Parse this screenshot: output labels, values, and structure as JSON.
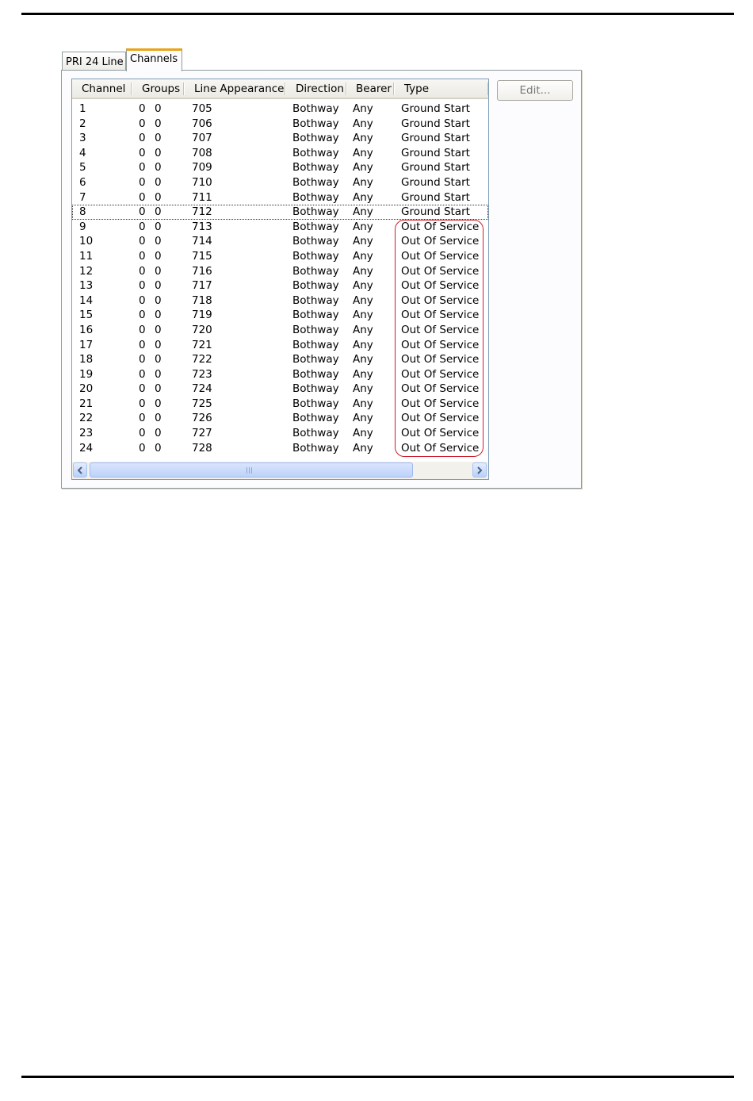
{
  "tabs": [
    {
      "label": "PRI 24 Line"
    },
    {
      "label": "Channels"
    }
  ],
  "columns": [
    "Channel",
    "Groups",
    "Line Appearance",
    "Direction",
    "Bearer",
    "Type"
  ],
  "edit_button": "Edit...",
  "rows": [
    {
      "channel": "1",
      "group_in": "0",
      "group_out": "0",
      "line_appearance": "705",
      "direction": "Bothway",
      "bearer": "Any",
      "type": "Ground Start"
    },
    {
      "channel": "2",
      "group_in": "0",
      "group_out": "0",
      "line_appearance": "706",
      "direction": "Bothway",
      "bearer": "Any",
      "type": "Ground Start"
    },
    {
      "channel": "3",
      "group_in": "0",
      "group_out": "0",
      "line_appearance": "707",
      "direction": "Bothway",
      "bearer": "Any",
      "type": "Ground Start"
    },
    {
      "channel": "4",
      "group_in": "0",
      "group_out": "0",
      "line_appearance": "708",
      "direction": "Bothway",
      "bearer": "Any",
      "type": "Ground Start"
    },
    {
      "channel": "5",
      "group_in": "0",
      "group_out": "0",
      "line_appearance": "709",
      "direction": "Bothway",
      "bearer": "Any",
      "type": "Ground Start"
    },
    {
      "channel": "6",
      "group_in": "0",
      "group_out": "0",
      "line_appearance": "710",
      "direction": "Bothway",
      "bearer": "Any",
      "type": "Ground Start"
    },
    {
      "channel": "7",
      "group_in": "0",
      "group_out": "0",
      "line_appearance": "711",
      "direction": "Bothway",
      "bearer": "Any",
      "type": "Ground Start"
    },
    {
      "channel": "8",
      "group_in": "0",
      "group_out": "0",
      "line_appearance": "712",
      "direction": "Bothway",
      "bearer": "Any",
      "type": "Ground Start",
      "focused": true
    },
    {
      "channel": "9",
      "group_in": "0",
      "group_out": "0",
      "line_appearance": "713",
      "direction": "Bothway",
      "bearer": "Any",
      "type": "Out Of Service"
    },
    {
      "channel": "10",
      "group_in": "0",
      "group_out": "0",
      "line_appearance": "714",
      "direction": "Bothway",
      "bearer": "Any",
      "type": "Out Of Service"
    },
    {
      "channel": "11",
      "group_in": "0",
      "group_out": "0",
      "line_appearance": "715",
      "direction": "Bothway",
      "bearer": "Any",
      "type": "Out Of Service"
    },
    {
      "channel": "12",
      "group_in": "0",
      "group_out": "0",
      "line_appearance": "716",
      "direction": "Bothway",
      "bearer": "Any",
      "type": "Out Of Service"
    },
    {
      "channel": "13",
      "group_in": "0",
      "group_out": "0",
      "line_appearance": "717",
      "direction": "Bothway",
      "bearer": "Any",
      "type": "Out Of Service"
    },
    {
      "channel": "14",
      "group_in": "0",
      "group_out": "0",
      "line_appearance": "718",
      "direction": "Bothway",
      "bearer": "Any",
      "type": "Out Of Service"
    },
    {
      "channel": "15",
      "group_in": "0",
      "group_out": "0",
      "line_appearance": "719",
      "direction": "Bothway",
      "bearer": "Any",
      "type": "Out Of Service"
    },
    {
      "channel": "16",
      "group_in": "0",
      "group_out": "0",
      "line_appearance": "720",
      "direction": "Bothway",
      "bearer": "Any",
      "type": "Out Of Service"
    },
    {
      "channel": "17",
      "group_in": "0",
      "group_out": "0",
      "line_appearance": "721",
      "direction": "Bothway",
      "bearer": "Any",
      "type": "Out Of Service"
    },
    {
      "channel": "18",
      "group_in": "0",
      "group_out": "0",
      "line_appearance": "722",
      "direction": "Bothway",
      "bearer": "Any",
      "type": "Out Of Service"
    },
    {
      "channel": "19",
      "group_in": "0",
      "group_out": "0",
      "line_appearance": "723",
      "direction": "Bothway",
      "bearer": "Any",
      "type": "Out Of Service"
    },
    {
      "channel": "20",
      "group_in": "0",
      "group_out": "0",
      "line_appearance": "724",
      "direction": "Bothway",
      "bearer": "Any",
      "type": "Out Of Service"
    },
    {
      "channel": "21",
      "group_in": "0",
      "group_out": "0",
      "line_appearance": "725",
      "direction": "Bothway",
      "bearer": "Any",
      "type": "Out Of Service"
    },
    {
      "channel": "22",
      "group_in": "0",
      "group_out": "0",
      "line_appearance": "726",
      "direction": "Bothway",
      "bearer": "Any",
      "type": "Out Of Service"
    },
    {
      "channel": "23",
      "group_in": "0",
      "group_out": "0",
      "line_appearance": "727",
      "direction": "Bothway",
      "bearer": "Any",
      "type": "Out Of Service"
    },
    {
      "channel": "24",
      "group_in": "0",
      "group_out": "0",
      "line_appearance": "728",
      "direction": "Bothway",
      "bearer": "Any",
      "type": "Out Of Service"
    }
  ],
  "colors": {
    "tab_accent": "#e8a317",
    "highlight_outline": "#cc1f2d",
    "scrollbar": "#bdd2f9"
  },
  "icons": {
    "scroll_left": "chevron-left-icon",
    "scroll_right": "chevron-right-icon"
  }
}
